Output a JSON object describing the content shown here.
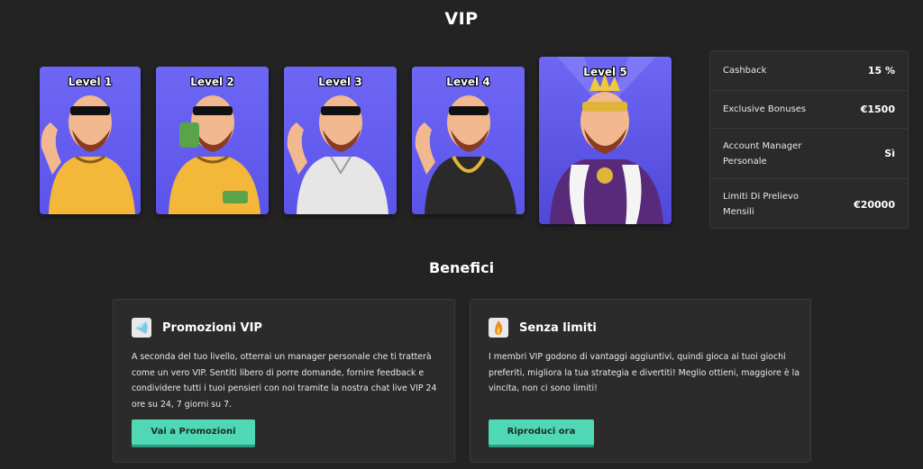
{
  "page": {
    "title": "VIP"
  },
  "levels": [
    {
      "label": "Level 1"
    },
    {
      "label": "Level 2"
    },
    {
      "label": "Level 3"
    },
    {
      "label": "Level 4"
    },
    {
      "label": "Level 5"
    }
  ],
  "info": [
    {
      "label": "Cashback",
      "value": "15 %"
    },
    {
      "label": "Exclusive Bonuses",
      "value": "€1500"
    },
    {
      "label": "Account Manager Personale",
      "value": "Sì"
    },
    {
      "label": "Limiti Di Prelievo Mensili",
      "value": "€20000"
    }
  ],
  "benefits": {
    "title": "Benefici",
    "items": [
      {
        "title": "Promozioni VIP",
        "icon": "diamond-icon",
        "text": "A seconda del tuo livello, otterrai un manager personale che ti tratterà come un vero VIP. Sentiti libero di porre domande, fornire feedback e condividere tutti i tuoi pensieri con noi tramite la nostra chat live VIP 24 ore su 24, 7 giorni su 7.",
        "button": "Vai a Promozioni"
      },
      {
        "title": "Senza limiti",
        "icon": "flame-icon",
        "text": "I membri VIP godono di vantaggi aggiuntivi, quindi gioca ai tuoi giochi preferiti, migliora la tua strategia e divertiti! Meglio ottieni, maggiore è la vincita, non ci sono limiti!",
        "button": "Riproduci ora"
      }
    ]
  },
  "colors": {
    "card_bg": "#6e66f4",
    "button": "#4fd8b3",
    "page_bg": "#232323"
  }
}
